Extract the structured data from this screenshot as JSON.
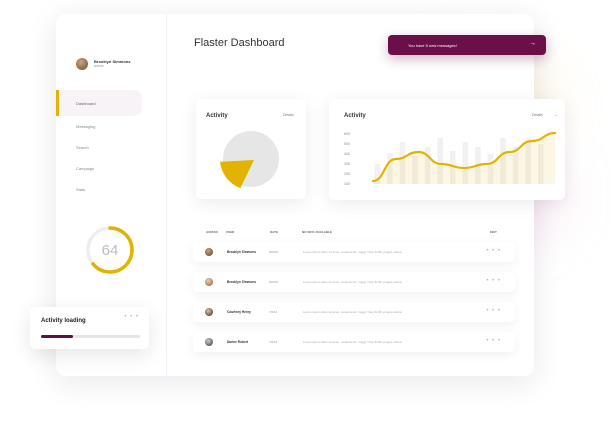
{
  "app": {
    "title": "Flaster Dashboard"
  },
  "user": {
    "name": "Brooklyn Simmons",
    "role": "admin"
  },
  "sidebar": {
    "items": [
      {
        "label": "Dashboard",
        "active": true
      },
      {
        "label": "Messaging",
        "active": false
      },
      {
        "label": "Search",
        "active": false
      },
      {
        "label": "Campaign",
        "active": false
      },
      {
        "label": "Stats",
        "active": false
      }
    ],
    "progress_value": "64",
    "progress_fraction": 0.64
  },
  "notification": {
    "text": "You have 5 new messages!",
    "icon": "arrow-right-icon"
  },
  "activity_small": {
    "title": "Activity",
    "link": "Details"
  },
  "activity_big": {
    "title": "Activity",
    "link": "Details"
  },
  "chart_data": {
    "type": "line",
    "title": "Activity",
    "y_ticks": [
      "600",
      "500",
      "400",
      "300",
      "200",
      "100"
    ],
    "ylim": [
      100,
      600
    ],
    "series": [
      {
        "values": [
          130,
          350,
          420,
          300,
          260,
          300,
          420,
          530,
          610
        ]
      }
    ],
    "bars": [
      300,
      410,
      520,
      380,
      470,
      560,
      430,
      520,
      470,
      400,
      560,
      470,
      560,
      500
    ],
    "colors": {
      "line": "#e2b300",
      "bars": "#f2f0f0"
    }
  },
  "pie": {
    "slice_fraction": 0.18,
    "colors": {
      "main": "#e6e6e6",
      "slice": "#e2b300"
    }
  },
  "table": {
    "headers": [
      "AVATAR",
      "USER",
      "DATE",
      "NO INFO AVAILABLE",
      "EDIT"
    ],
    "rows": [
      {
        "name": "Brooklyn Simmons",
        "date": "8x8x6x",
        "desc": "Lorem ipsum dolor sit amet, consectetur; nuggy Yoter IGrifk yorgets otenia"
      },
      {
        "name": "Brooklyn Simmons",
        "date": "8x8x6x",
        "desc": "Lorem ipsum dolor sit amet, consectetur; nuggy Yoter IGrifk yorgets otenia"
      },
      {
        "name": "Courtney Henry",
        "date": "7/6/16",
        "desc": "Lorem ipsum dolor sit amet, consectetur; nuggy Yoter IGrifk yorgets otenia"
      },
      {
        "name": "Darine Robert",
        "date": "7/6/16",
        "desc": "Lorem ipsum dolor sit amet, consectetur; nuggy Yoter IGrifk yorgets otenia"
      }
    ]
  },
  "loading": {
    "title": "Activity loading",
    "fraction": 0.32
  },
  "colors": {
    "accent": "#e2b300",
    "brand": "#6a0f48"
  }
}
